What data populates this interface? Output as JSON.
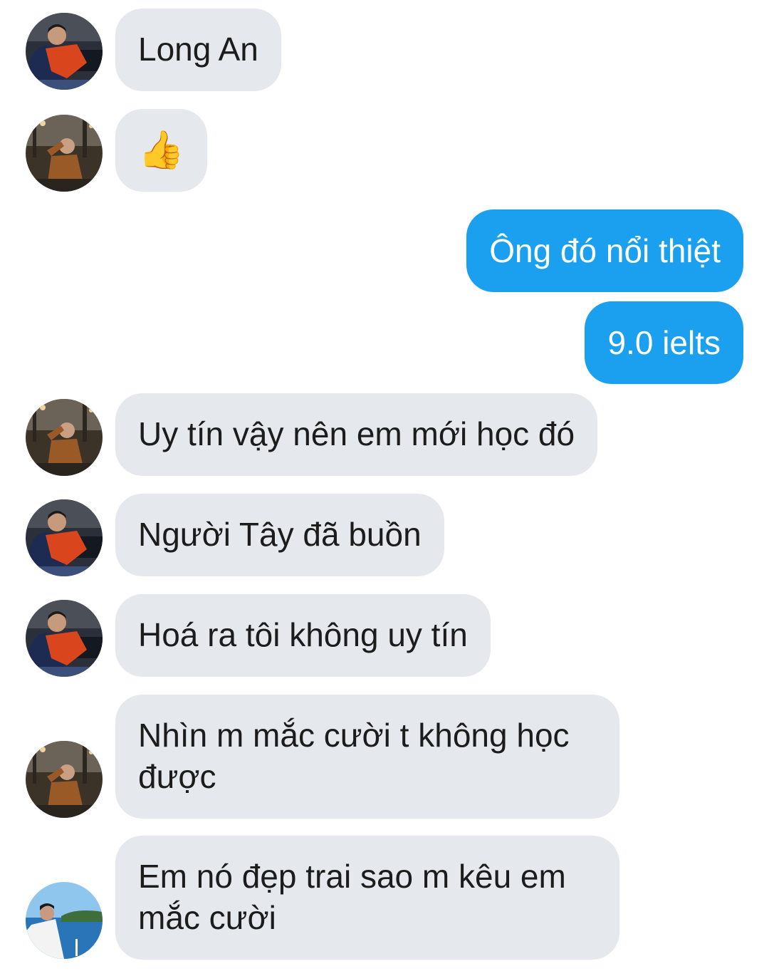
{
  "messages": [
    {
      "side": "in",
      "sender": "friend-a",
      "text": "Long An"
    },
    {
      "side": "in",
      "sender": "friend-b",
      "text": "👍"
    },
    {
      "side": "out",
      "text": "Ông đó nổi thiệt"
    },
    {
      "side": "out",
      "text": "9.0 ielts"
    },
    {
      "side": "in",
      "sender": "friend-b",
      "text": "Uy tín vậy nên em mới học đó"
    },
    {
      "side": "in",
      "sender": "friend-a",
      "text": "Người Tây đã buồn"
    },
    {
      "side": "in",
      "sender": "friend-a",
      "text": "Hoá ra tôi không uy tín"
    },
    {
      "side": "in",
      "sender": "friend-b",
      "text": "Nhìn m mắc cười t không học được"
    },
    {
      "side": "in",
      "sender": "friend-c",
      "text": "Em nó đẹp trai sao m kêu em mắc cười"
    }
  ],
  "colors": {
    "incoming_bubble": "#e5e8ec",
    "outgoing_bubble": "#1aa0ee",
    "incoming_text": "#1c1c1c",
    "outgoing_text": "#ffffff"
  }
}
